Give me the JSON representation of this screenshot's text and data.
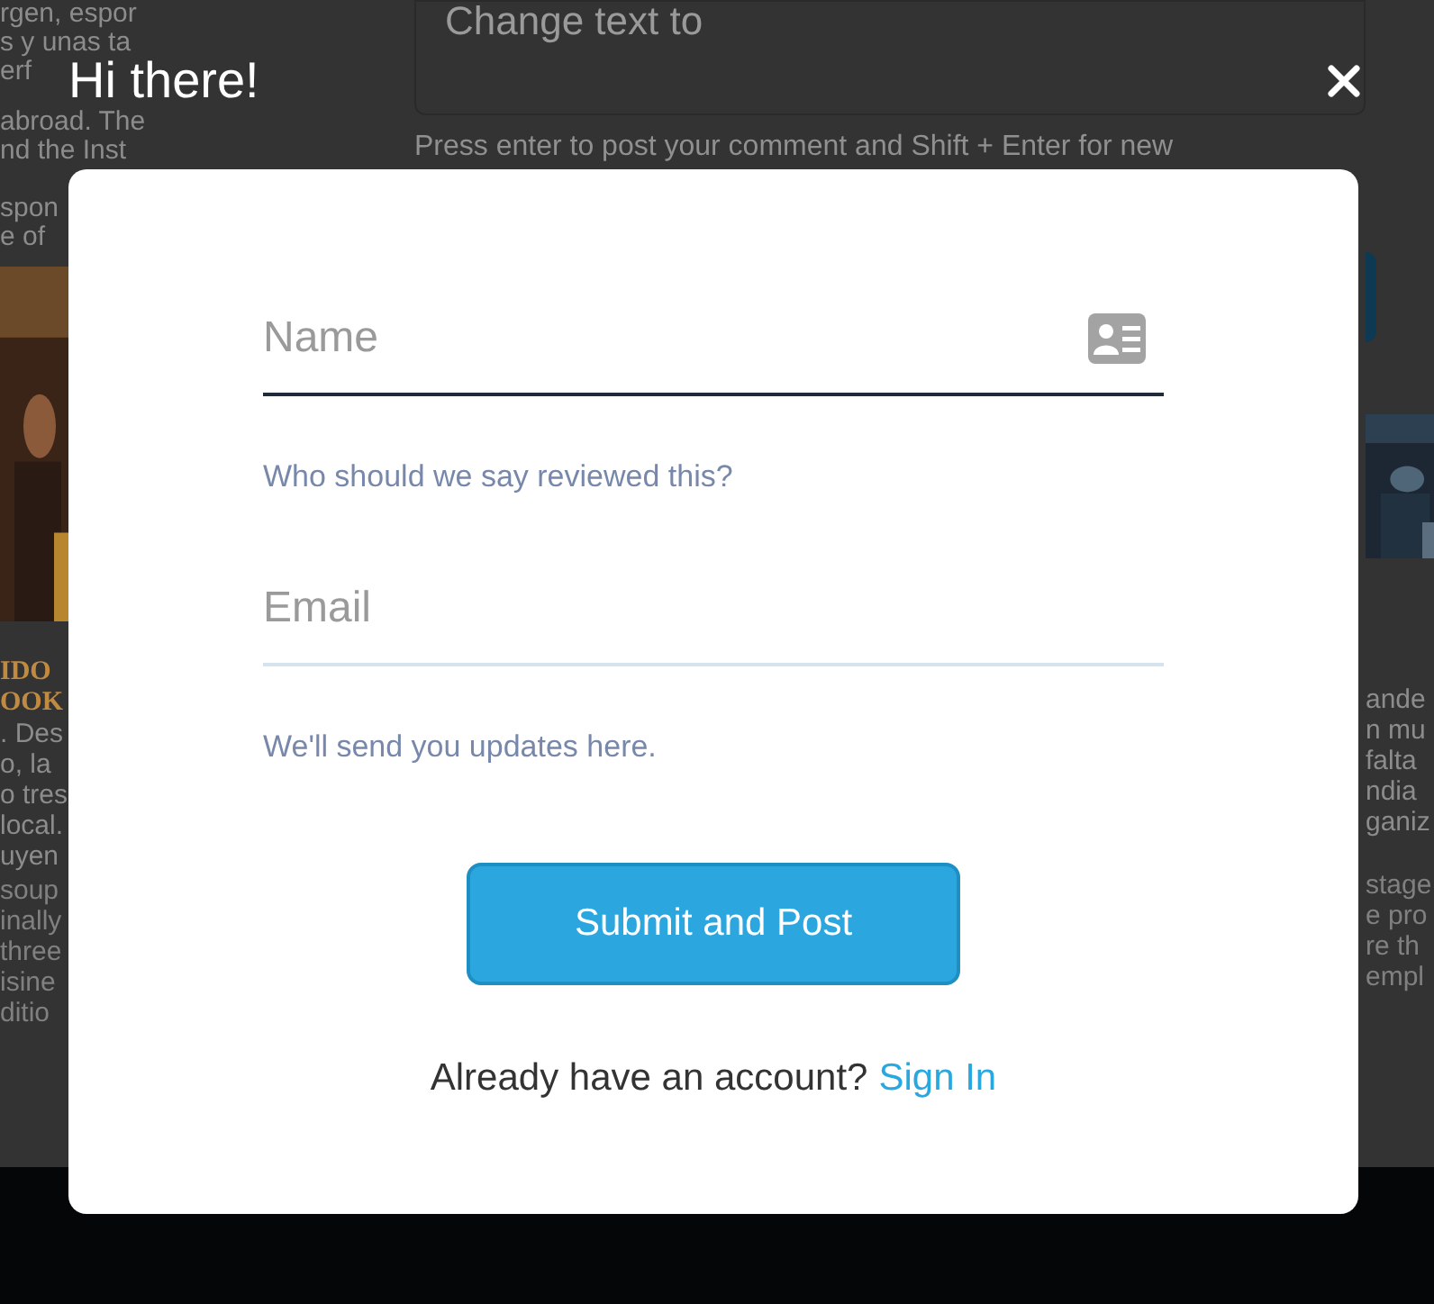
{
  "background": {
    "comment_box": {
      "value": "Change text to",
      "hint": "Press enter to post your comment and Shift + Enter for new"
    },
    "left_column": {
      "top_lines": [
        "rgen, espor",
        "s y unas ta",
        "erf",
        "abroad. The",
        "nd the Inst",
        "spon",
        "e of"
      ],
      "heading": [
        "IDO",
        "OOK"
      ],
      "body": [
        ". Des",
        "o, la",
        "o tres",
        "local.",
        "uyen"
      ],
      "body_translation": [
        "soup",
        "inally",
        "three",
        "isine",
        "ditio"
      ]
    },
    "right_column": {
      "body": [
        "ande",
        "n mu",
        "falta",
        "ndia",
        "ganiz"
      ],
      "body_translation": [
        "stage",
        "e pro",
        "re th",
        "empl"
      ]
    }
  },
  "modal": {
    "title": "Hi there!",
    "fields": [
      {
        "kind": "name",
        "placeholder": "Name",
        "focused": true,
        "hint": "Who should we say reviewed this?"
      },
      {
        "kind": "email",
        "placeholder": "Email",
        "focused": false,
        "hint": "We'll send you updates here."
      }
    ],
    "submit": "Submit and Post",
    "footer": {
      "text": "Already have an account?",
      "link": "Sign In"
    }
  }
}
